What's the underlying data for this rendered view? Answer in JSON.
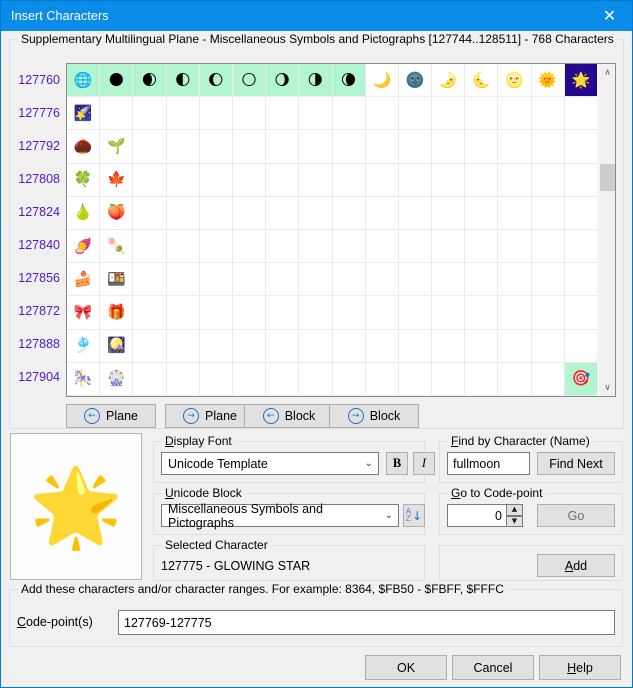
{
  "window": {
    "title": "Insert Characters",
    "close_icon": "close-icon",
    "close_glyph": "✕"
  },
  "grid_group": {
    "legend": "Supplementary Multilingual Plane - Miscellaneous Symbols and Pictographs [127744..128511] - 768 Characters",
    "row_labels": [
      "127760",
      "127776",
      "127792",
      "127808",
      "127824",
      "127840",
      "127856",
      "127872",
      "127888",
      "127904"
    ],
    "columns": 16,
    "rows": 10,
    "selected_range_start": 127769,
    "selected_range_end": 127775,
    "current_codepoint": 127775,
    "cells": [
      {
        "r": 0,
        "c": 0,
        "glyph": "🌐",
        "state": "range"
      },
      {
        "r": 0,
        "c": 1,
        "glyph": "🌑",
        "state": "range"
      },
      {
        "r": 0,
        "c": 2,
        "glyph": "🌒",
        "state": "range"
      },
      {
        "r": 0,
        "c": 3,
        "glyph": "🌓",
        "state": "range"
      },
      {
        "r": 0,
        "c": 4,
        "glyph": "🌔",
        "state": "range"
      },
      {
        "r": 0,
        "c": 5,
        "glyph": "🌕",
        "state": "range"
      },
      {
        "r": 0,
        "c": 6,
        "glyph": "🌖",
        "state": "range"
      },
      {
        "r": 0,
        "c": 7,
        "glyph": "🌗",
        "state": "range"
      },
      {
        "r": 0,
        "c": 8,
        "glyph": "🌘",
        "state": "range"
      },
      {
        "r": 0,
        "c": 9,
        "glyph": "🌙",
        "state": "none"
      },
      {
        "r": 0,
        "c": 10,
        "glyph": "🌚",
        "state": "none"
      },
      {
        "r": 0,
        "c": 11,
        "glyph": "🌛",
        "state": "none"
      },
      {
        "r": 0,
        "c": 12,
        "glyph": "🌜",
        "state": "none"
      },
      {
        "r": 0,
        "c": 13,
        "glyph": "🌝",
        "state": "none"
      },
      {
        "r": 0,
        "c": 14,
        "glyph": "🌞",
        "state": "none"
      },
      {
        "r": 0,
        "c": 15,
        "glyph": "🌟",
        "state": "current"
      },
      {
        "r": 1,
        "c": 0,
        "glyph": "🌠",
        "state": "none"
      },
      {
        "r": 2,
        "c": 0,
        "glyph": "🌰",
        "state": "none"
      },
      {
        "r": 2,
        "c": 1,
        "glyph": "🌱",
        "state": "none"
      },
      {
        "r": 3,
        "c": 0,
        "glyph": "🍀",
        "state": "none"
      },
      {
        "r": 3,
        "c": 1,
        "glyph": "🍁",
        "state": "none"
      },
      {
        "r": 4,
        "c": 0,
        "glyph": "🍐",
        "state": "none"
      },
      {
        "r": 4,
        "c": 1,
        "glyph": "🍑",
        "state": "none"
      },
      {
        "r": 5,
        "c": 0,
        "glyph": "🍠",
        "state": "none"
      },
      {
        "r": 5,
        "c": 1,
        "glyph": "🍡",
        "state": "none"
      },
      {
        "r": 6,
        "c": 0,
        "glyph": "🍰",
        "state": "none"
      },
      {
        "r": 6,
        "c": 1,
        "glyph": "🍱",
        "state": "none"
      },
      {
        "r": 7,
        "c": 0,
        "glyph": "🎀",
        "state": "none"
      },
      {
        "r": 7,
        "c": 1,
        "glyph": "🎁",
        "state": "none"
      },
      {
        "r": 8,
        "c": 0,
        "glyph": "🎐",
        "state": "none"
      },
      {
        "r": 8,
        "c": 1,
        "glyph": "🎑",
        "state": "none"
      },
      {
        "r": 9,
        "c": 0,
        "glyph": "🎠",
        "state": "none"
      },
      {
        "r": 9,
        "c": 1,
        "glyph": "🎡",
        "state": "none"
      },
      {
        "r": 9,
        "c": 15,
        "glyph": "🎯",
        "state": "range"
      }
    ],
    "scrollbar": {
      "up_icon": "chevron-up-icon",
      "up_glyph": "∧",
      "down_icon": "chevron-down-icon",
      "down_glyph": "∨"
    }
  },
  "nav_buttons": [
    {
      "name": "prev-plane",
      "label": "Plane",
      "arrow": "←",
      "icon": "arrow-left-circle-icon"
    },
    {
      "name": "next-plane",
      "label": "Plane",
      "arrow": "→",
      "icon": "arrow-right-circle-icon"
    },
    {
      "name": "prev-block",
      "label": "Block",
      "arrow": "←",
      "icon": "arrow-left-circle-icon"
    },
    {
      "name": "next-block",
      "label": "Block",
      "arrow": "→",
      "icon": "arrow-right-circle-icon"
    }
  ],
  "preview": {
    "glyph": "🌟"
  },
  "display_font": {
    "legend_underlined": "D",
    "legend_rest": "isplay Font",
    "value": "Unicode Template",
    "bold_label": "B",
    "italic_label": "I",
    "chevron": "⌄"
  },
  "unicode_block": {
    "legend_underlined": "U",
    "legend_rest": "nicode Block",
    "value": "Miscellaneous Symbols and Pictographs",
    "sort_icon": "sort-az-icon",
    "sort_a": "A",
    "sort_z": "Z",
    "sort_arrow": "↓",
    "chevron": "⌄"
  },
  "selected_character": {
    "legend": "Selected Character",
    "value": "127775 - GLOWING STAR"
  },
  "find_by_character": {
    "legend_underlined": "F",
    "legend_rest": "ind by Character (Name)",
    "value": "fullmoon",
    "placeholder": "",
    "button_label": "Find Next"
  },
  "goto_codepoint": {
    "legend_underlined": "G",
    "legend_rest": "o to Code-point",
    "value": "0",
    "button_label": "Go",
    "spin_up": "▲",
    "spin_down": "▼"
  },
  "add_section": {
    "button_underlined": "A",
    "button_rest": "dd"
  },
  "codepoints": {
    "legend": "Add these characters and/or character ranges. For example: 8364, $FB50 - $FBFF, $FFFC",
    "field_underlined": "C",
    "field_rest": "ode-point(s)",
    "value": "127769-127775",
    "placeholder": ""
  },
  "dialog_buttons": {
    "ok": "OK",
    "cancel": "Cancel",
    "help_underlined": "H",
    "help_rest": "elp"
  },
  "colors": {
    "titlebar": "#0c8ce9",
    "selection_range": "#b3f5d1",
    "selection_current": "#260a8c",
    "row_label": "#5019c8",
    "accent": "#1e6fbe"
  }
}
